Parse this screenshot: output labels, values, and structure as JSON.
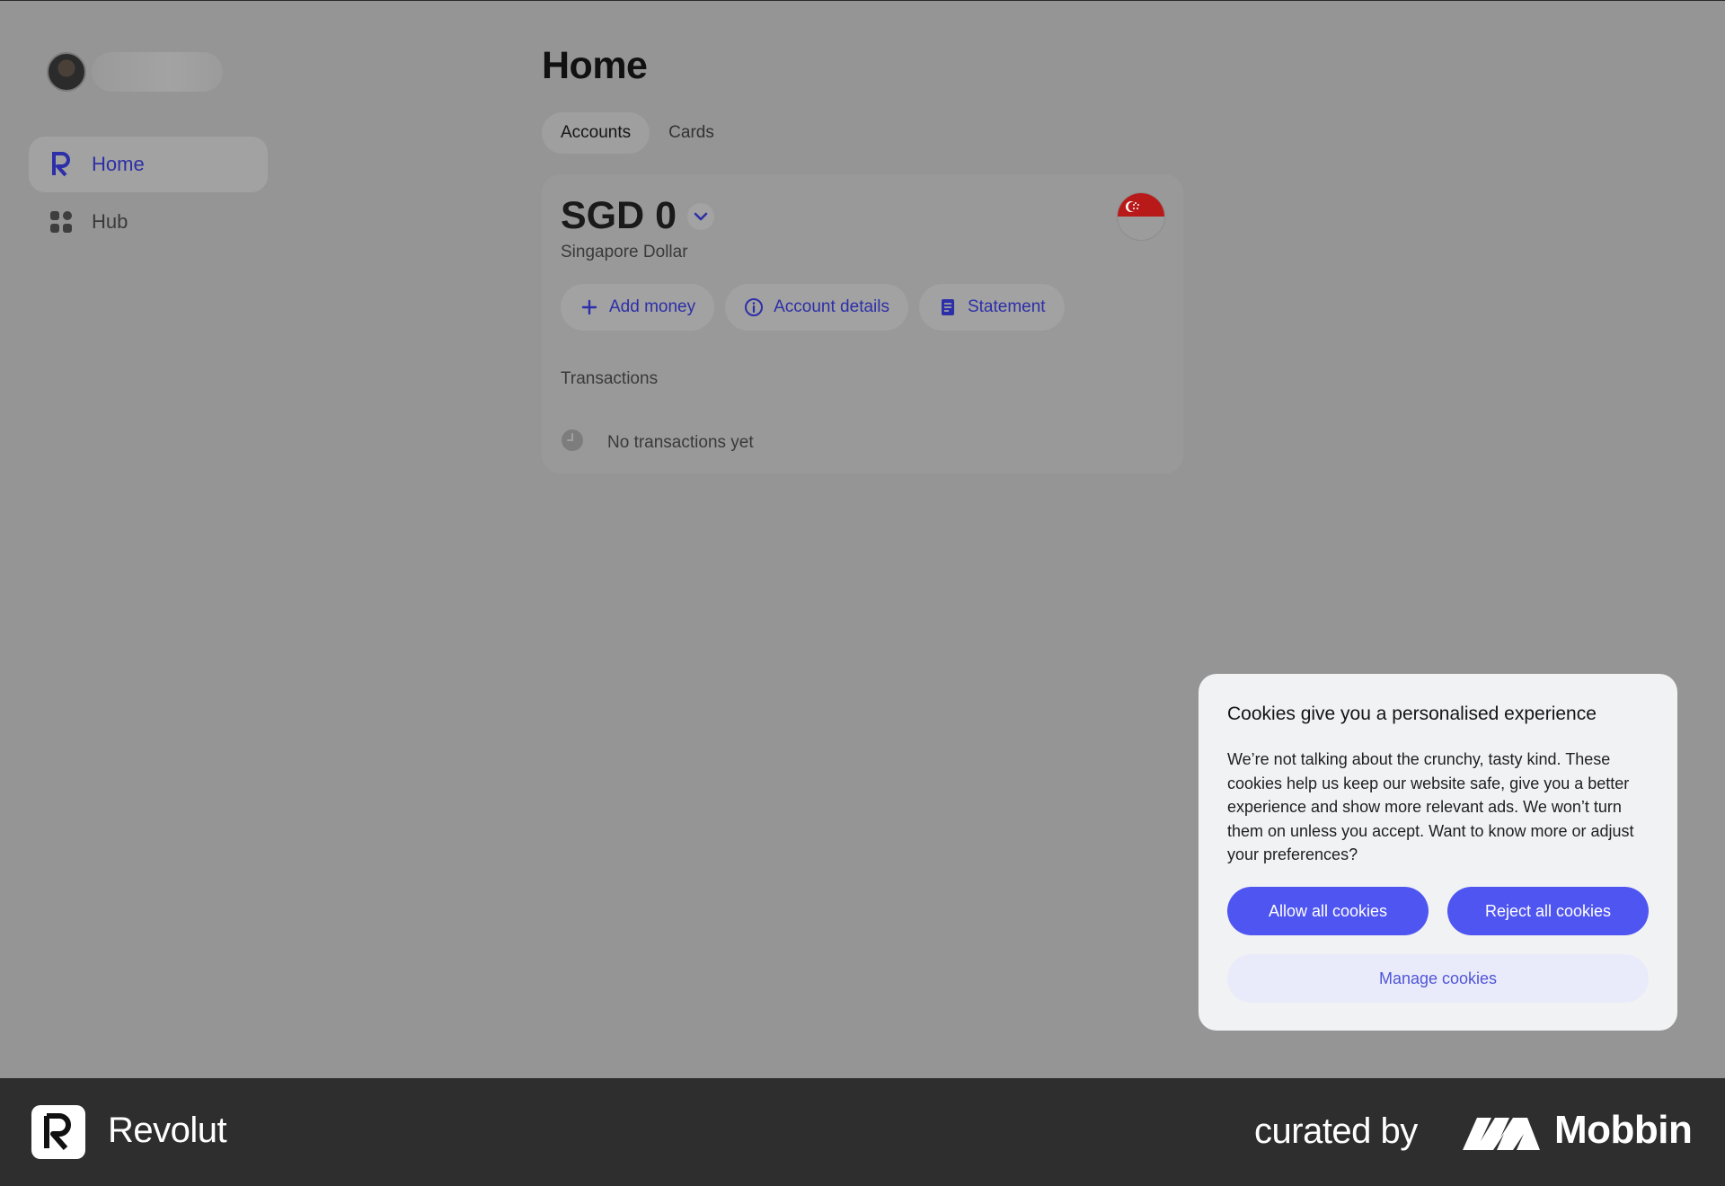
{
  "sidebar": {
    "items": [
      {
        "label": "Home",
        "icon": "revolut-r-icon",
        "active": true
      },
      {
        "label": "Hub",
        "icon": "grid-icon",
        "active": false
      }
    ]
  },
  "main": {
    "title": "Home",
    "tabs": [
      {
        "label": "Accounts",
        "active": true
      },
      {
        "label": "Cards",
        "active": false
      }
    ],
    "account": {
      "balance": "SGD 0",
      "currency_name": "Singapore Dollar",
      "flag_icon": "singapore-flag-icon",
      "actions": [
        {
          "label": "Add money",
          "icon": "plus-icon"
        },
        {
          "label": "Account details",
          "icon": "info-icon"
        },
        {
          "label": "Statement",
          "icon": "document-icon"
        }
      ],
      "transactions_heading": "Transactions",
      "empty_text": "No transactions yet"
    }
  },
  "cookie_dialog": {
    "title": "Cookies give you a personalised experience",
    "body": "We’re not talking about the crunchy, tasty kind. These cookies help us keep our website safe, give you a better experience and show more relevant ads. We won’t turn them on unless you accept. Want to know more or adjust your preferences?",
    "allow_label": "Allow all cookies",
    "reject_label": "Reject all cookies",
    "manage_label": "Manage cookies"
  },
  "footer": {
    "app_name": "Revolut",
    "curated_by": "curated by",
    "brand": "Mobbin"
  },
  "colors": {
    "accent": "#4f55f0",
    "accent_text": "#2d2fa8",
    "overlay": "#959595",
    "footer_bg": "#2e2e2e"
  }
}
